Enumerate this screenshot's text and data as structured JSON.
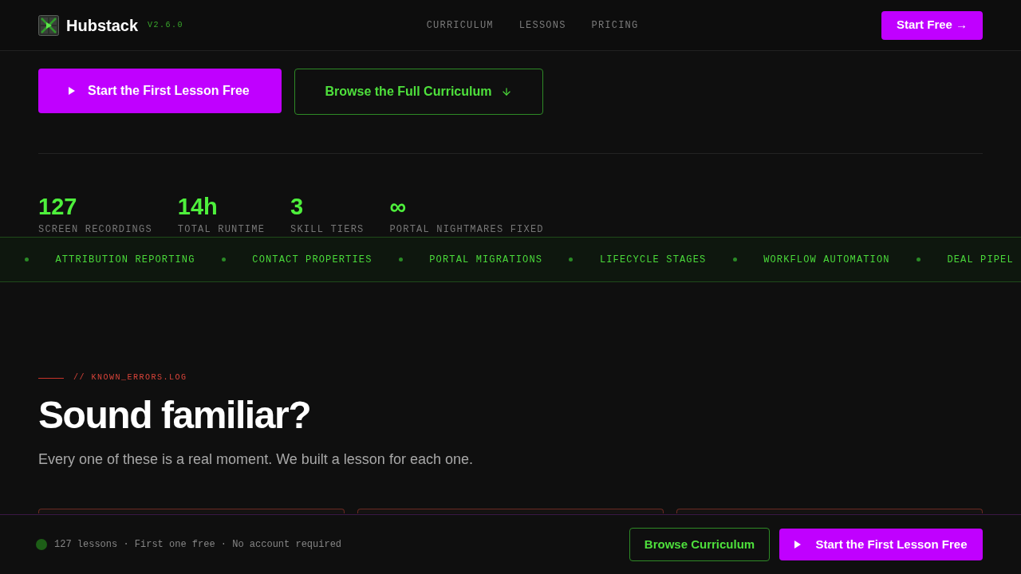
{
  "header": {
    "brand": "Hubstack",
    "version": "V2.6.0",
    "nav": [
      {
        "label": "CURRICULUM"
      },
      {
        "label": "LESSONS"
      },
      {
        "label": "PRICING"
      }
    ],
    "cta": "Start Free →"
  },
  "hero": {
    "buttons": [
      {
        "label": "Start the First Lesson Free",
        "kind": "primary"
      },
      {
        "label": "Browse the Full Curriculum",
        "kind": "secondary"
      }
    ]
  },
  "stats": [
    {
      "value": "127",
      "label": "SCREEN RECORDINGS"
    },
    {
      "value": "14h",
      "label": "TOTAL RUNTIME"
    },
    {
      "value": "3",
      "label": "SKILL TIERS"
    },
    {
      "value": "∞",
      "label": "PORTAL NIGHTMARES FIXED"
    }
  ],
  "ticker": [
    "ATTRIBUTION REPORTING",
    "CONTACT PROPERTIES",
    "PORTAL MIGRATIONS",
    "LIFECYCLE STAGES",
    "WORKFLOW AUTOMATION",
    "DEAL PIPEL"
  ],
  "section": {
    "eyebrow": "// KNOWN_ERRORS.LOG",
    "title": "Sound familiar?",
    "subtitle": "Every one of these is a real moment. We built a lesson for each one."
  },
  "bottom_bar": {
    "note": "127 lessons · First one free · No account required",
    "buttons": [
      {
        "label": "Browse Curriculum",
        "kind": "secondary"
      },
      {
        "label": "Start the First Lesson Free",
        "kind": "primary"
      }
    ]
  }
}
